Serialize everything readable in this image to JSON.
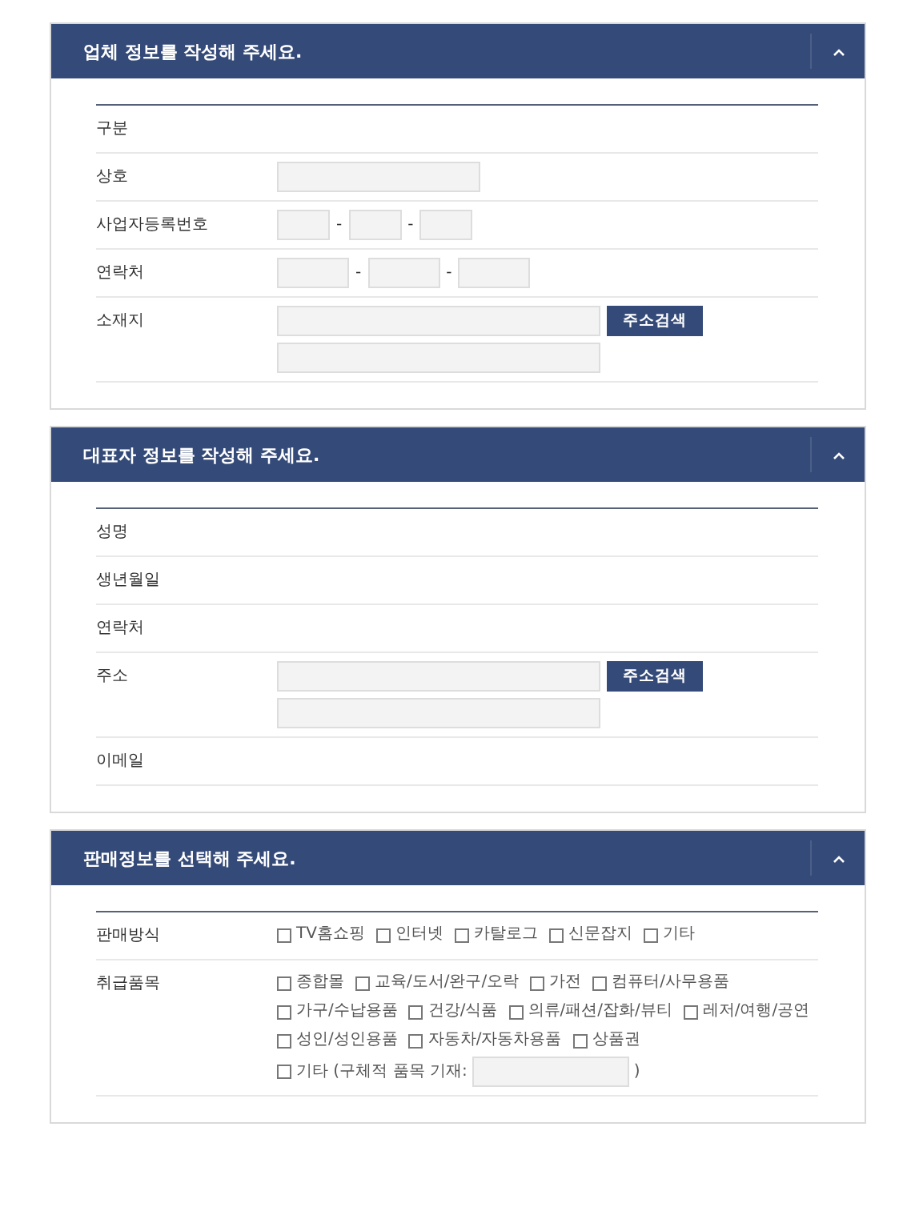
{
  "sections": [
    {
      "title": "업체 정보를 작성해 주세요.",
      "expanded": true,
      "rows": [
        {
          "kind": "plain",
          "label": "구분"
        },
        {
          "kind": "text",
          "label": "상호"
        },
        {
          "kind": "bizno",
          "label": "사업자등록번호",
          "separators": [
            "-",
            "-"
          ]
        },
        {
          "kind": "phone",
          "label": "연락처",
          "separators": [
            "-",
            "-"
          ]
        },
        {
          "kind": "address",
          "label": "소재지",
          "button": "주소검색"
        }
      ]
    },
    {
      "title": "대표자 정보를 작성해 주세요.",
      "expanded": true,
      "rows": [
        {
          "kind": "plain",
          "label": "성명"
        },
        {
          "kind": "plain",
          "label": "생년월일"
        },
        {
          "kind": "plain",
          "label": "연락처"
        },
        {
          "kind": "address",
          "label": "주소",
          "button": "주소검색"
        },
        {
          "kind": "plain",
          "label": "이메일"
        }
      ]
    },
    {
      "title": "판매정보를 선택해 주세요.",
      "expanded": true,
      "rows": [
        {
          "kind": "checks",
          "label": "판매방식",
          "options": [
            {
              "label": "TV홈쇼핑",
              "checked": false
            },
            {
              "label": "인터넷",
              "checked": false
            },
            {
              "label": "카탈로그",
              "checked": false
            },
            {
              "label": "신문잡지",
              "checked": false
            },
            {
              "label": "기타",
              "checked": false
            }
          ]
        },
        {
          "kind": "checks",
          "label": "취급품목",
          "options": [
            {
              "label": "종합몰",
              "checked": false
            },
            {
              "label": "교육/도서/완구/오락",
              "checked": false
            },
            {
              "label": "가전",
              "checked": false
            },
            {
              "label": "컴퓨터/사무용품",
              "checked": false
            },
            {
              "label": "가구/수납용품",
              "checked": false
            },
            {
              "label": "건강/식품",
              "checked": false
            },
            {
              "label": "의류/패션/잡화/뷰티",
              "checked": false
            },
            {
              "label": "레저/여행/공연",
              "checked": false
            },
            {
              "label": "성인/성인용품",
              "checked": false
            },
            {
              "label": "자동차/자동차용품",
              "checked": false
            },
            {
              "label": "상품권",
              "checked": false
            },
            {
              "kind": "other",
              "label": "기타 (구체적 품목 기재:",
              "checked": false,
              "suffix": ")"
            }
          ]
        }
      ]
    }
  ]
}
